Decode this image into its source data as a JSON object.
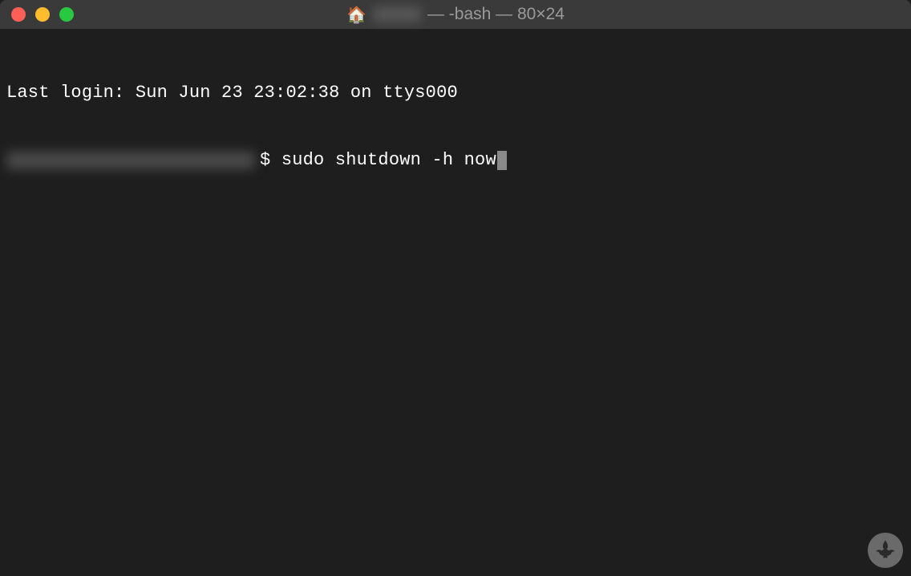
{
  "titlebar": {
    "title_suffix": " — -bash — 80×24"
  },
  "terminal": {
    "last_login": "Last login: Sun Jun 23 23:02:38 on ttys000",
    "prompt_symbol": "$ ",
    "command": "sudo shutdown -h now"
  }
}
